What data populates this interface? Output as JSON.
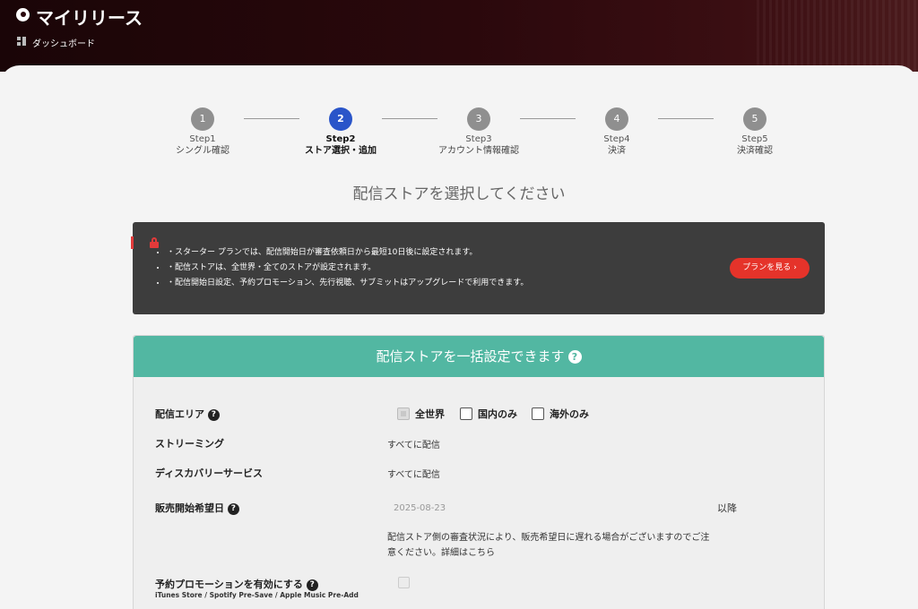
{
  "header": {
    "app_title": "マイリリース",
    "breadcrumb": "ダッシュボード",
    "logo_icon": "eye-logo-icon",
    "breadcrumb_icon": "dashboard-grid-icon"
  },
  "stepper": {
    "steps": [
      {
        "number": "1",
        "label": "Step1",
        "name": "シングル確認",
        "active": false
      },
      {
        "number": "2",
        "label": "Step2",
        "name": "ストア選択・追加",
        "active": true
      },
      {
        "number": "3",
        "label": "Step3",
        "name": "アカウント情報確認",
        "active": false
      },
      {
        "number": "4",
        "label": "Step4",
        "name": "決済",
        "active": false
      },
      {
        "number": "5",
        "label": "Step5",
        "name": "決済確認",
        "active": false
      }
    ]
  },
  "page_heading": "配信ストアを選択してください",
  "notice": {
    "icon": "lock-icon",
    "items": [
      "・スターター プランでは、配信開始日が審査依頼日から最短10日後に設定されます。",
      "・配信ストアは、全世界・全てのストアが設定されます。",
      "・配信開始日設定、予約プロモーション、先行視聴、サブミットはアップグレードで利用できます。"
    ],
    "plan_button": "プランを見る ›"
  },
  "bulk": {
    "title": "配信ストアを一括設定できます",
    "help_icon": "?",
    "area_label": "配信エリア",
    "area_options": [
      "全世界",
      "国内のみ",
      "海外のみ"
    ],
    "streaming_label": "ストリーミング",
    "streaming_value": "すべてに配信",
    "discovery_label": "ディスカバリーサービス",
    "discovery_value": "すべてに配信",
    "sale_date_label": "販売開始希望日",
    "sale_date_value": "2025-08-23",
    "sale_date_suffix": "以降",
    "sale_date_note": "配信ストア側の審査状況により、販売希望日に遅れる場合がございますのでご注意ください。詳細はこちら",
    "promo_label": "予約プロモーションを有効にする",
    "promo_sub": "iTunes Store / Spotify Pre-Save / Apple Music Pre-Add"
  },
  "colors": {
    "accent_blue": "#2a55c9",
    "teal": "#52b7a2",
    "red": "#e5332a",
    "notice_bg": "#3d3d3d"
  }
}
